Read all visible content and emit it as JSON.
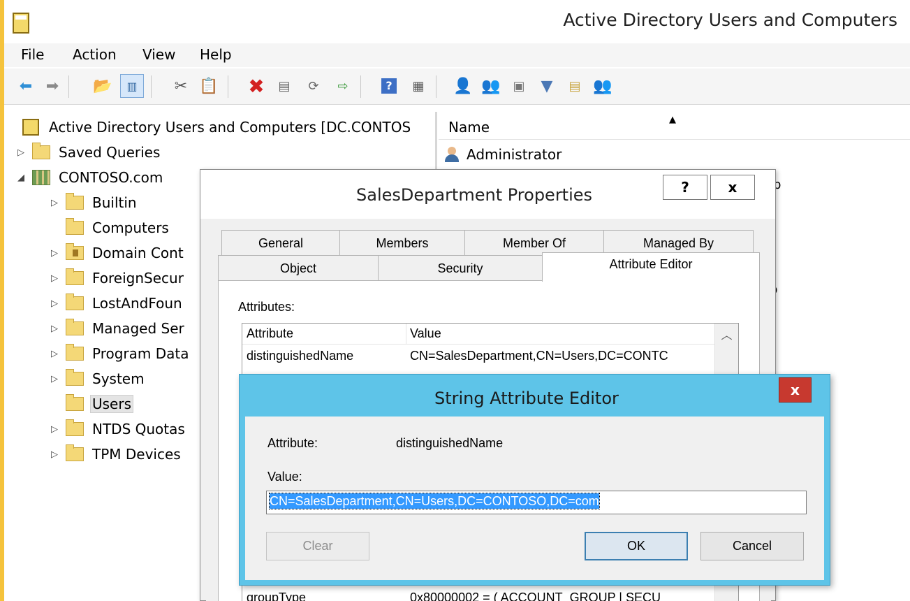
{
  "app": {
    "title": "Active Directory Users and Computers",
    "menu": [
      "File",
      "Action",
      "View",
      "Help"
    ]
  },
  "toolbar": {
    "icons": [
      "back-arrow-icon",
      "forward-arrow-icon",
      "up-folder-icon",
      "show-hide-console-tree-icon",
      "cut-icon",
      "copy-icon",
      "delete-icon",
      "properties-icon",
      "refresh-icon",
      "export-list-icon",
      "help-icon",
      "show-action-pane-icon",
      "new-user-icon",
      "new-group-icon",
      "new-ou-icon",
      "filter-icon",
      "find-icon",
      "add-to-group-icon"
    ]
  },
  "tree": {
    "root": "Active Directory Users and Computers [DC.CONTOS",
    "items": [
      {
        "label": "Saved Queries",
        "expander": "▷"
      },
      {
        "label": "CONTOSO.com",
        "expander": "◢"
      },
      {
        "label": "Builtin",
        "expander": "▷"
      },
      {
        "label": "Computers",
        "expander": ""
      },
      {
        "label": "Domain Cont",
        "expander": "▷"
      },
      {
        "label": "ForeignSecur",
        "expander": "▷"
      },
      {
        "label": "LostAndFoun",
        "expander": "▷"
      },
      {
        "label": "Managed Ser",
        "expander": "▷"
      },
      {
        "label": "Program Data",
        "expander": "▷"
      },
      {
        "label": "System",
        "expander": "▷"
      },
      {
        "label": "Users",
        "expander": ""
      },
      {
        "label": "NTDS Quotas",
        "expander": "▷"
      },
      {
        "label": "TPM Devices",
        "expander": "▷"
      }
    ],
    "selected": "Users"
  },
  "list": {
    "column_name": "Name",
    "sort_indicator": "▲",
    "rows": [
      "Administrator"
    ],
    "fragments": [
      "ıp",
      "b"
    ]
  },
  "props_dialog": {
    "title": "SalesDepartment Properties",
    "help_label": "?",
    "close_label": "x",
    "tabs_row1": [
      "General",
      "Members",
      "Member Of",
      "Managed By"
    ],
    "tabs_row2": [
      "Object",
      "Security",
      "Attribute Editor"
    ],
    "active_tab": "Attribute Editor",
    "attributes_caption": "Attributes:",
    "columns": [
      "Attribute",
      "Value"
    ],
    "rows": [
      {
        "attribute": "distinguishedName",
        "value": "CN=SalesDepartment,CN=Users,DC=CONTC"
      },
      {
        "attribute": "groupType",
        "value": "0x80000002 = ( ACCOUNT_GROUP | SECU"
      }
    ]
  },
  "string_editor": {
    "title": "String Attribute Editor",
    "close_label": "x",
    "attribute_label": "Attribute:",
    "attribute_value": "distinguishedName",
    "value_label": "Value:",
    "value": "CN=SalesDepartment,CN=Users,DC=CONTOSO,DC=com",
    "clear_label": "Clear",
    "ok_label": "OK",
    "cancel_label": "Cancel"
  }
}
